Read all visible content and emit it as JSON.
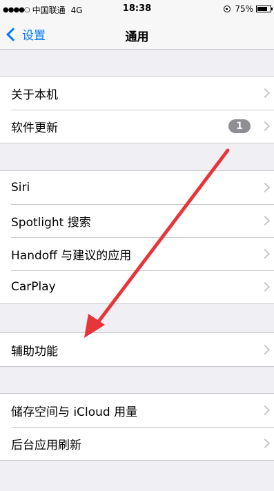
{
  "status_bar": {
    "signal_dots": "●●●●○",
    "carrier": "中国联通",
    "network": "4G",
    "time": "18:38",
    "battery_percent": "75%",
    "battery_level": 0.75
  },
  "nav": {
    "back_label": "设置",
    "title": "通用"
  },
  "groups": [
    {
      "items": [
        {
          "label": "关于本机"
        },
        {
          "label": "软件更新",
          "badge": "1"
        }
      ]
    },
    {
      "items": [
        {
          "label": "Siri"
        },
        {
          "label": "Spotlight 搜索"
        },
        {
          "label": "Handoff 与建议的应用"
        },
        {
          "label": "CarPlay"
        }
      ]
    },
    {
      "items": [
        {
          "label": "辅助功能"
        }
      ]
    },
    {
      "items": [
        {
          "label": "储存空间与 iCloud 用量"
        },
        {
          "label": "后台应用刷新"
        }
      ]
    }
  ],
  "colors": {
    "accent": "#007aff",
    "annotation_arrow": "#e8353a"
  }
}
